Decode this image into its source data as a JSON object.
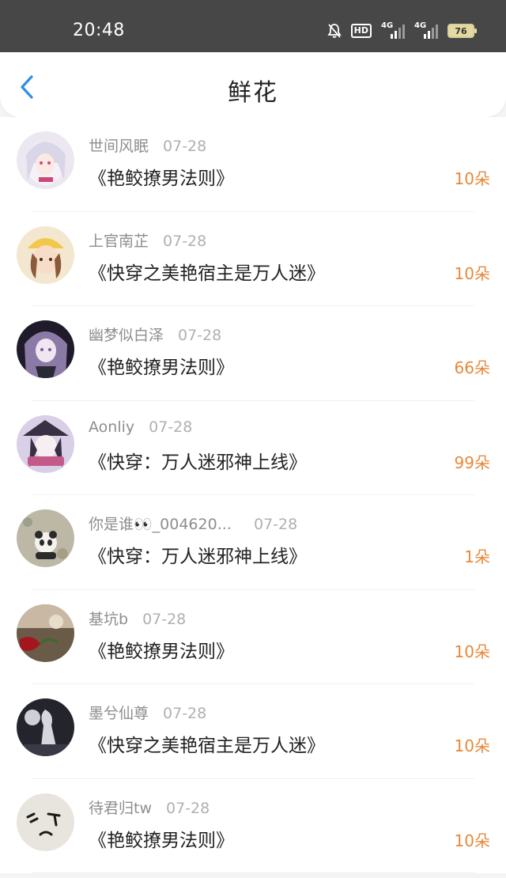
{
  "status_bar": {
    "time": "20:48",
    "hd_label": "HD",
    "sig1_label": "4G",
    "sig2_label": "4G",
    "battery": "76"
  },
  "header": {
    "title": "鲜花",
    "back_icon": "chevron-left-icon",
    "accent_color": "#2f8fe6"
  },
  "rows": [
    {
      "name": "世间风眠",
      "date": "07-28",
      "book": "《艳鲛撩男法则》",
      "count": "10朵"
    },
    {
      "name": "上官南芷",
      "date": "07-28",
      "book": "《快穿之美艳宿主是万人迷》",
      "count": "10朵"
    },
    {
      "name": "幽梦似白泽",
      "date": "07-28",
      "book": "《艳鲛撩男法则》",
      "count": "66朵"
    },
    {
      "name": "Aonliy",
      "date": "07-28",
      "book": "《快穿：万人迷邪神上线》",
      "count": "99朵"
    },
    {
      "name": "你是谁👀_004620...",
      "date": "07-28",
      "book": "《快穿：万人迷邪神上线》",
      "count": "1朵"
    },
    {
      "name": "基坑b",
      "date": "07-28",
      "book": "《艳鲛撩男法则》",
      "count": "10朵"
    },
    {
      "name": "墨兮仙尊",
      "date": "07-28",
      "book": "《快穿之美艳宿主是万人迷》",
      "count": "10朵"
    },
    {
      "name": "待君归tw",
      "date": "07-28",
      "book": "《艳鲛撩男法则》",
      "count": "10朵"
    }
  ],
  "count_color": "#e8883a"
}
